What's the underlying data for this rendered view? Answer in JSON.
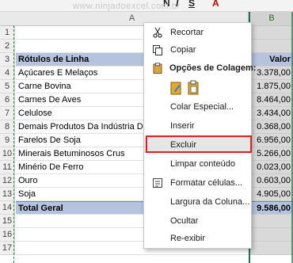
{
  "watermark": "www.ninjadoexcel.com.br",
  "ribbon": {
    "letters": [
      "N",
      "I",
      "S",
      "A"
    ]
  },
  "columns": {
    "a": "A",
    "b": "B"
  },
  "rows": [
    {
      "num": "1",
      "a": "",
      "b": ""
    },
    {
      "num": "2",
      "a": "",
      "b": ""
    },
    {
      "num": "3",
      "a": "Rótulos de Linha",
      "b": "Valor"
    },
    {
      "num": "4",
      "a": "Açúcares E Melaços",
      "b": "3.378,00"
    },
    {
      "num": "5",
      "a": "Carne Bovina",
      "b": "1.875,00"
    },
    {
      "num": "6",
      "a": "Carnes De Aves",
      "b": "8.464,00"
    },
    {
      "num": "7",
      "a": "Celulose",
      "b": "3.434,00"
    },
    {
      "num": "8",
      "a": "Demais Produtos Da Indústria De",
      "b": "0.368,00"
    },
    {
      "num": "9",
      "a": "Farelos De Soja",
      "b": "6.956,00"
    },
    {
      "num": "10",
      "a": "Minerais Betuminosos Crus",
      "b": "5.266,00"
    },
    {
      "num": "11",
      "a": "Minério De Ferro",
      "b": "0.023,00"
    },
    {
      "num": "12",
      "a": "Ouro",
      "b": "0.603,00"
    },
    {
      "num": "13",
      "a": "Soja",
      "b": "4.905,00"
    },
    {
      "num": "14",
      "a": "Total Geral",
      "b": "9.586,00"
    },
    {
      "num": "15",
      "a": "",
      "b": ""
    },
    {
      "num": "16",
      "a": "",
      "b": ""
    },
    {
      "num": "17",
      "a": "",
      "b": ""
    }
  ],
  "menu": {
    "recortar": "Recortar",
    "copiar": "Copiar",
    "opcoes_colagem": "Opções de Colagem:",
    "colar_especial": "Colar Especial...",
    "inserir": "Inserir",
    "excluir": "Excluir",
    "limpar": "Limpar conteúdo",
    "formatar": "Formatar células...",
    "largura": "Largura da Coluna...",
    "ocultar": "Ocultar",
    "reexibir": "Re-exibir"
  },
  "colors": {
    "selection": "#217346",
    "highlight": "#e02020",
    "header_fill": "#b5c3df"
  }
}
